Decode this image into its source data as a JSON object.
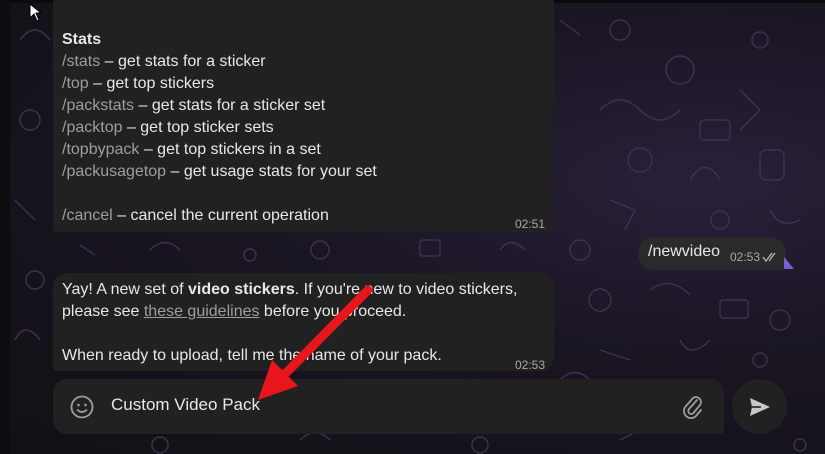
{
  "messages": [
    {
      "heading": "Stats",
      "lines": [
        {
          "cmd": "/stats",
          "text": " – get stats for a sticker"
        },
        {
          "cmd": "/top",
          "text": " – get top stickers"
        },
        {
          "cmd": "/packstats",
          "text": " – get stats for a sticker set"
        },
        {
          "cmd": "/packtop",
          "text": " – get top sticker sets"
        },
        {
          "cmd": "/topbypack",
          "text": " – get top stickers in a set"
        },
        {
          "cmd": "/packusagetop",
          "text": " – get usage stats for your set"
        }
      ],
      "cancel": {
        "cmd": "/cancel",
        "text": " – cancel the current operation"
      },
      "time": "02:51"
    },
    {
      "outgoing_text": "/newvideo",
      "time": "02:53",
      "status_icon": "double-check-icon"
    },
    {
      "part1": "Yay! A new set of ",
      "bold": "video stickers",
      "part2": ". If you're new to video stickers,",
      "part3": "please see ",
      "link": "these guidelines",
      "part4": " before you proceed.",
      "part5": "When ready to upload, tell me the name of your pack.",
      "time": "02:53"
    }
  ],
  "composer": {
    "value": "Custom Video Pack",
    "emoji_icon": "emoji-icon",
    "attach_icon": "paperclip-icon",
    "send_icon": "send-icon"
  },
  "annotation": {
    "arrow_color": "#e8161a"
  },
  "colors": {
    "bubble": "#212121",
    "outgoing_tail": "#7b5dd6",
    "command_text": "#9e9e9e"
  }
}
